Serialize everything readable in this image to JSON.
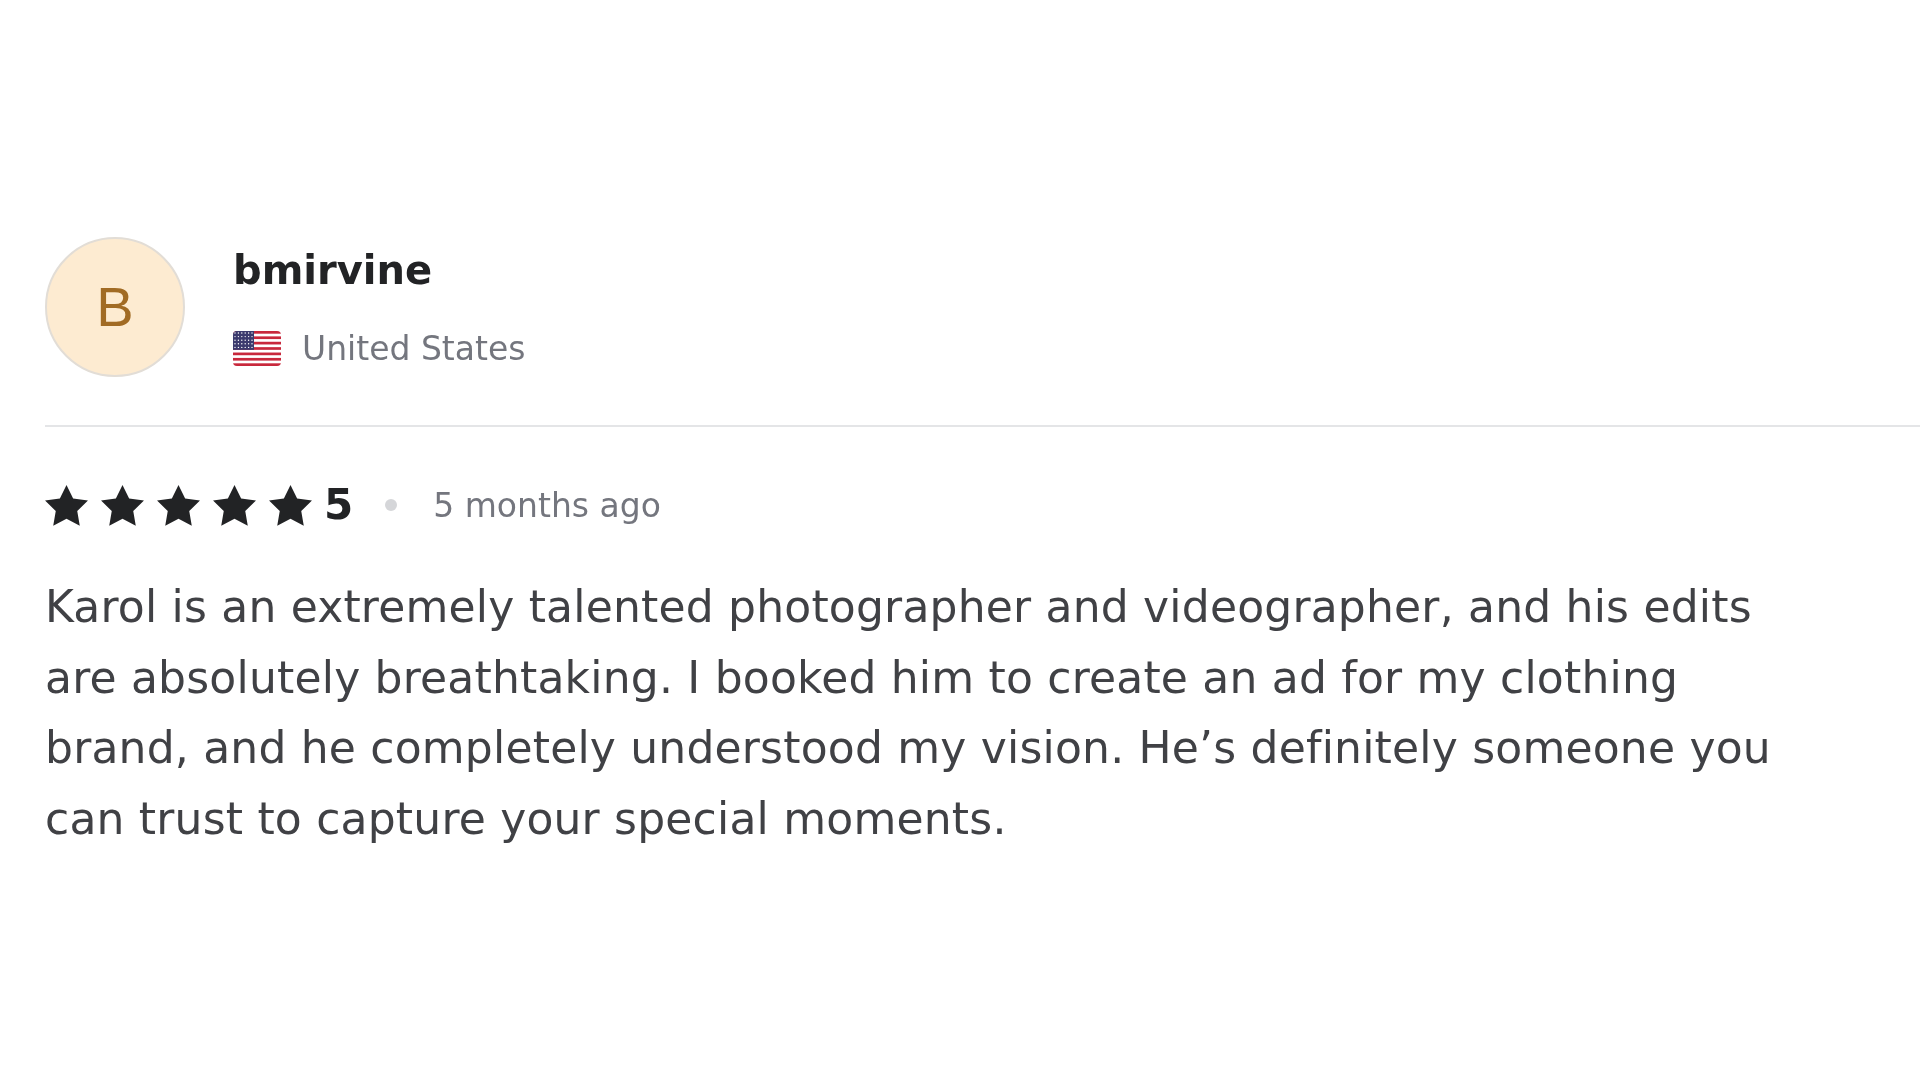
{
  "reviewer": {
    "avatar_letter": "B",
    "username": "bmirvine",
    "country": "United States"
  },
  "review": {
    "stars": 5,
    "rating": "5",
    "time": "5 months ago",
    "text": "Karol is an extremely talented photographer and videographer, and his edits are absolutely breathtaking. I booked him to create an ad for my clothing brand, and he completely understood my vision. He’s definitely someone you can trust to capture your special moments."
  }
}
